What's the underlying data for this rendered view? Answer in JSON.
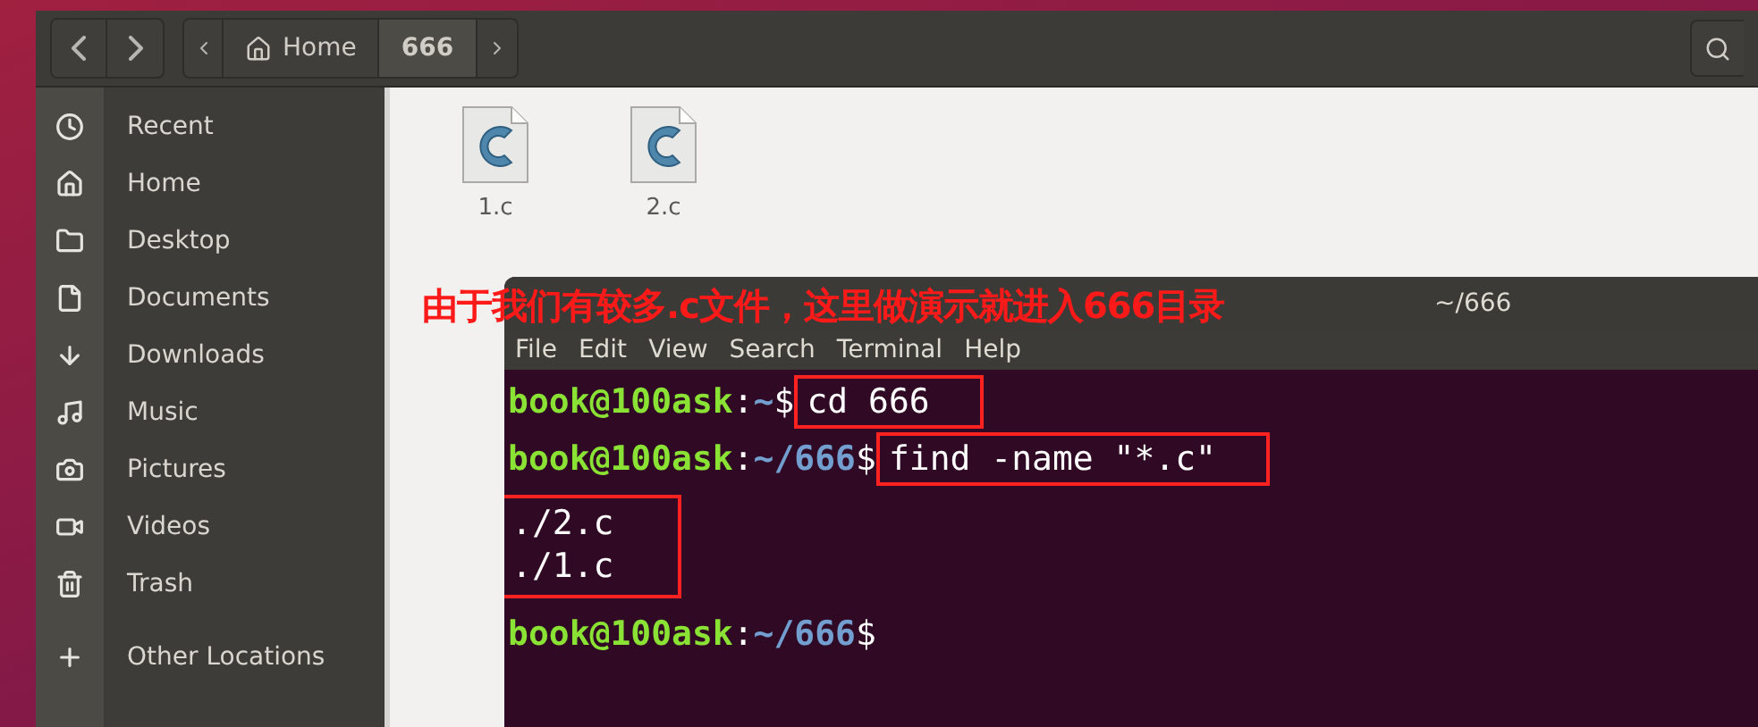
{
  "breadcrumb": [
    {
      "label": "Home",
      "kind": "home",
      "selected": false
    },
    {
      "label": "666",
      "kind": "folder",
      "selected": true
    }
  ],
  "sidebar": {
    "items": [
      {
        "label": "Recent",
        "kind": "recent"
      },
      {
        "label": "Home",
        "kind": "home"
      },
      {
        "label": "Desktop",
        "kind": "desktop"
      },
      {
        "label": "Documents",
        "kind": "documents"
      },
      {
        "label": "Downloads",
        "kind": "downloads"
      },
      {
        "label": "Music",
        "kind": "music"
      },
      {
        "label": "Pictures",
        "kind": "pictures"
      },
      {
        "label": "Videos",
        "kind": "videos"
      },
      {
        "label": "Trash",
        "kind": "trash"
      },
      {
        "label": "Other Locations",
        "kind": "other"
      }
    ]
  },
  "files": [
    {
      "name": "1.c"
    },
    {
      "name": "2.c"
    }
  ],
  "annotation": "由于我们有较多.c文件，这里做演示就进入666目录",
  "terminal": {
    "title": "~/666",
    "menu": [
      "File",
      "Edit",
      "View",
      "Search",
      "Terminal",
      "Help"
    ],
    "lines": [
      {
        "kind": "prompt",
        "user": "book@100ask",
        "sep": ":",
        "path": "~",
        "sign": "$",
        "command": "cd 666",
        "highlighted": true
      },
      {
        "kind": "prompt",
        "user": "book@100ask",
        "sep": ":",
        "path": "~/666",
        "sign": "$",
        "command": "find -name \"*.c\"",
        "highlighted": true
      },
      {
        "kind": "output",
        "lines": [
          "./2.c",
          "./1.c"
        ],
        "highlighted": true
      },
      {
        "kind": "prompt",
        "user": "book@100ask",
        "sep": ":",
        "path": "~/666",
        "sign": "$"
      }
    ]
  }
}
